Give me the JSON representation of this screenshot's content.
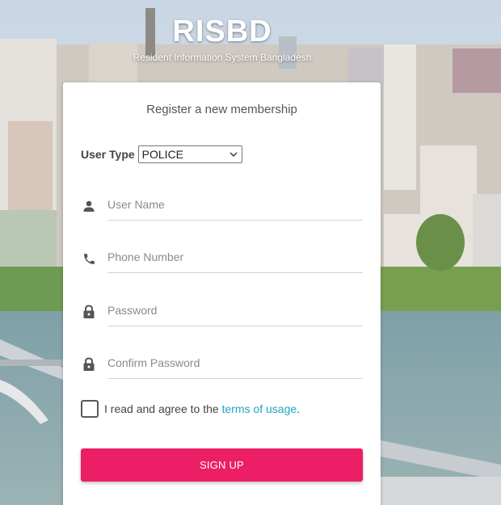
{
  "brand": {
    "logo": "RISBD",
    "tagline": "Resident Information System Bangladesh"
  },
  "form": {
    "title": "Register a new membership",
    "user_type": {
      "label": "User Type",
      "selected": "POLICE"
    },
    "fields": {
      "username": {
        "placeholder": "User Name",
        "icon": "person-icon"
      },
      "phone": {
        "placeholder": "Phone Number",
        "icon": "phone-icon"
      },
      "password": {
        "placeholder": "Password",
        "icon": "lock-icon"
      },
      "confirm_password": {
        "placeholder": "Confirm Password",
        "icon": "lock-icon"
      }
    },
    "agree": {
      "prefix": "I read and agree to the",
      "link": "terms of usage",
      "suffix": "."
    },
    "submit_label": "SIGN UP"
  },
  "colors": {
    "primary_button": "#ec1e65",
    "link": "#1ea5c8",
    "icon": "#555555"
  }
}
